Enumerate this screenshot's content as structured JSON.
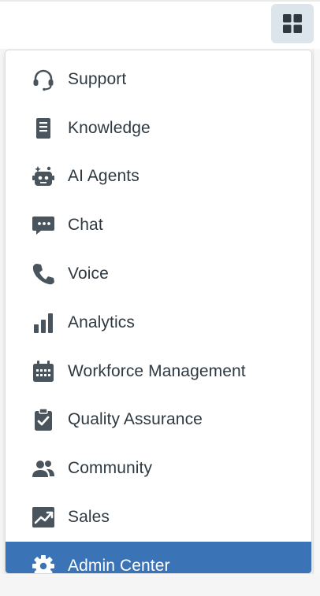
{
  "header": {
    "apps_button_icon": "grid-icon"
  },
  "menu": {
    "items": [
      {
        "label": "Support",
        "icon": "headset-icon",
        "active": false
      },
      {
        "label": "Knowledge",
        "icon": "book-icon",
        "active": false
      },
      {
        "label": "AI Agents",
        "icon": "robot-icon",
        "active": false
      },
      {
        "label": "Chat",
        "icon": "chat-bubble-icon",
        "active": false
      },
      {
        "label": "Voice",
        "icon": "phone-icon",
        "active": false
      },
      {
        "label": "Analytics",
        "icon": "bar-chart-icon",
        "active": false
      },
      {
        "label": "Workforce Management",
        "icon": "calendar-grid-icon",
        "active": false
      },
      {
        "label": "Quality Assurance",
        "icon": "clipboard-check-icon",
        "active": false
      },
      {
        "label": "Community",
        "icon": "people-icon",
        "active": false
      },
      {
        "label": "Sales",
        "icon": "trend-chart-icon",
        "active": false
      },
      {
        "label": "Admin Center",
        "icon": "gear-icon",
        "active": true
      }
    ]
  },
  "colors": {
    "active_bg": "#3a74b6",
    "icon": "#49545c",
    "text": "#2f3941",
    "apps_button_bg": "#dde5ec"
  }
}
